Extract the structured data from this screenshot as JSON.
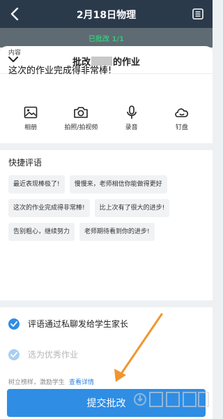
{
  "header": {
    "title": "2月18日物理"
  },
  "status": {
    "text": "已批改 1/1"
  },
  "sheet": {
    "title_prefix": "批改",
    "title_suffix": "的作业"
  },
  "content": {
    "label": "内容",
    "text": "这次的作业完成得非常棒!"
  },
  "tools": [
    {
      "icon": "image-icon",
      "label": "相册"
    },
    {
      "icon": "camera-icon",
      "label": "拍照/拍视频"
    },
    {
      "icon": "microphone-icon",
      "label": "录音"
    },
    {
      "icon": "cloud-drive-icon",
      "label": "钉盘"
    }
  ],
  "quick_comments": {
    "title": "快捷评语",
    "chips": [
      "最近表现棒极了!",
      "慢慢来，老师相信你能做得更好",
      "这次的作业完成得非常棒!",
      "比上次有了很大的进步!",
      "告别粗心，继续努力",
      "老师期待看到你的进步!"
    ]
  },
  "options": {
    "notify_parents": "评语通过私聊发给学生家长",
    "mark_excellent": "选为优秀作业"
  },
  "footnote": {
    "text": "树立榜样，激励学生",
    "link": "查看详情"
  },
  "submit": {
    "label": "提交批改"
  },
  "colors": {
    "accent": "#2f8de4",
    "topbar": "#2b3a4b",
    "success": "#39c37a"
  }
}
